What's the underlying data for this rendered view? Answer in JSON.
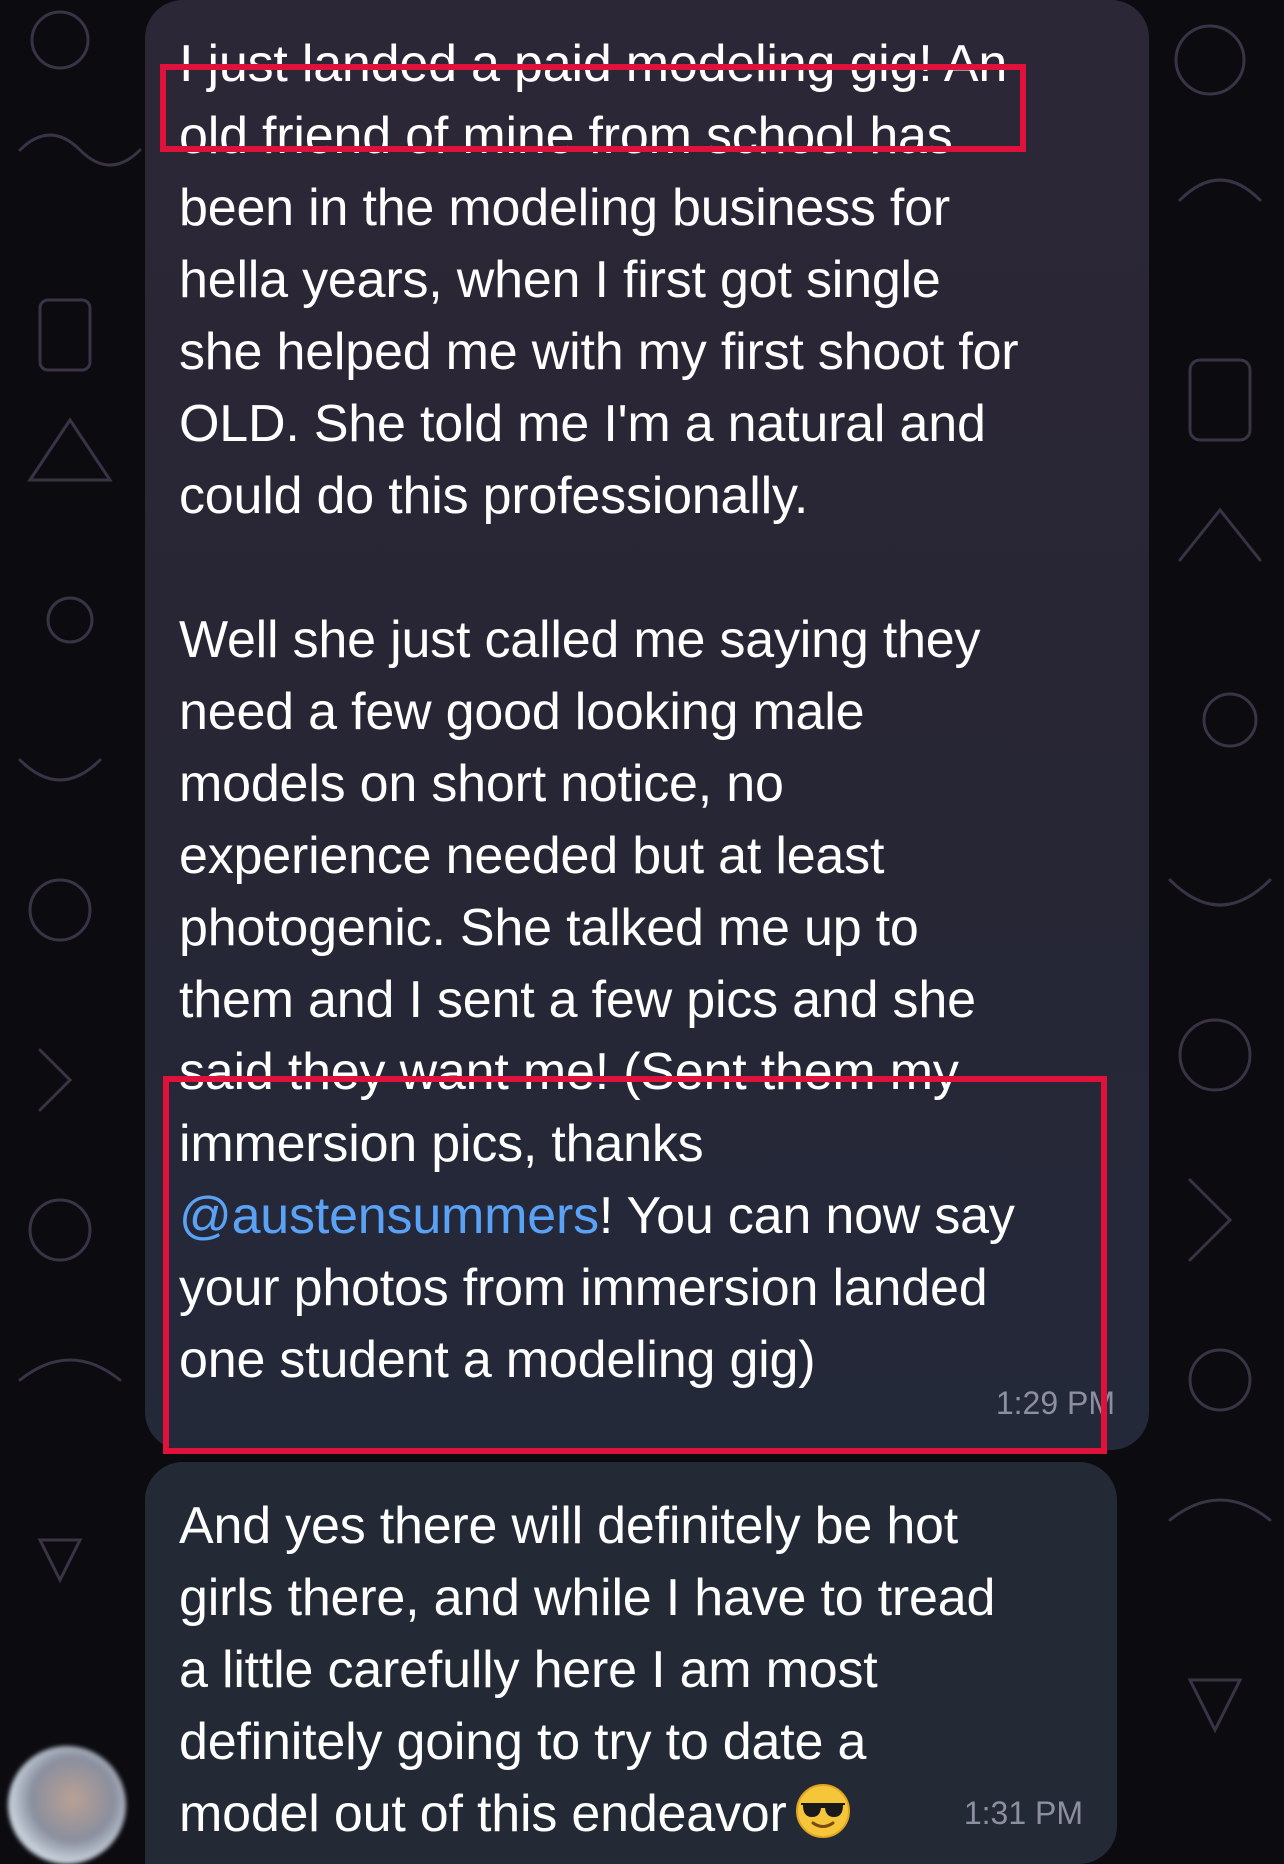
{
  "messages": [
    {
      "lines": [
        "I just landed a paid modeling gig! An",
        "old friend of mine from school has",
        "been in the modeling business for",
        "hella years, when I first got single",
        "she helped me with my first shoot for",
        "OLD. She told me I'm a natural and",
        "could do this professionally.",
        "",
        "Well she just called me saying they",
        "need a few good looking male",
        "models on short notice, no",
        "experience needed but at least",
        "photogenic. She talked me up to",
        "them and I sent a few pics and she",
        "said they want me! (Sent them my",
        "immersion pics, thanks"
      ],
      "mention": "@austensummers",
      "after_mention": "! You can now say",
      "tail_lines": [
        "your photos from immersion landed",
        "one student a modeling gig)"
      ],
      "time": "1:29 PM"
    },
    {
      "lines": [
        "And yes there will definitely be hot",
        "girls there, and while I have to tread",
        "a little carefully here I am most",
        "definitely going to try to date a",
        "model out of this endeavor"
      ],
      "emoji": "smiling-face-with-sunglasses",
      "time": "1:31 PM"
    }
  ],
  "colors": {
    "bubble": "#2a2838",
    "text": "#ffffff",
    "mention": "#5aa2f5",
    "timestamp": "#8d8fa0",
    "highlight": "#e0123c"
  }
}
